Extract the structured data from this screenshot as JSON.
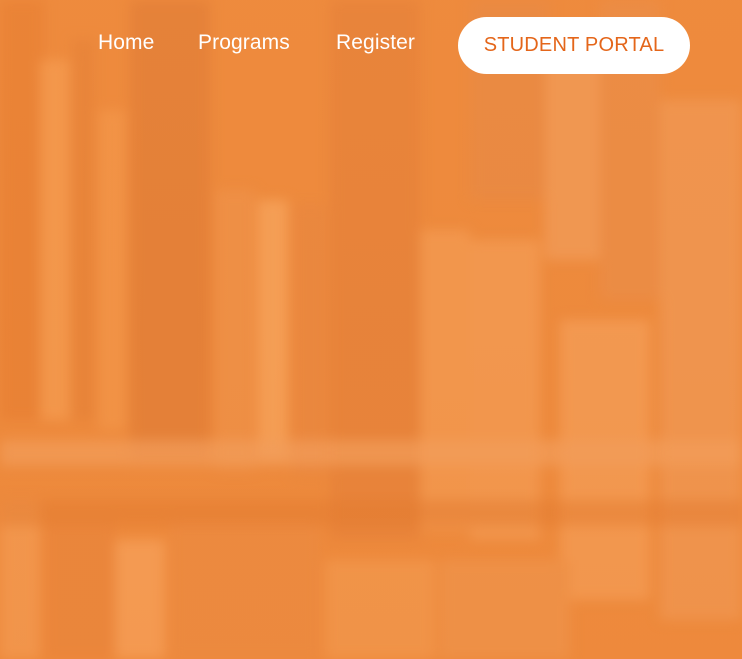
{
  "colors": {
    "hero_base": "#ee8b3e",
    "nav_text": "#ffffff",
    "button_bg": "#ffffff",
    "button_text": "#e4661a"
  },
  "nav": {
    "links": [
      {
        "label": "Home"
      },
      {
        "label": "Programs"
      },
      {
        "label": "Register"
      }
    ],
    "portal_button_label": "STUDENT PORTAL"
  },
  "background": {
    "icon": "bookshelf-background-image"
  }
}
